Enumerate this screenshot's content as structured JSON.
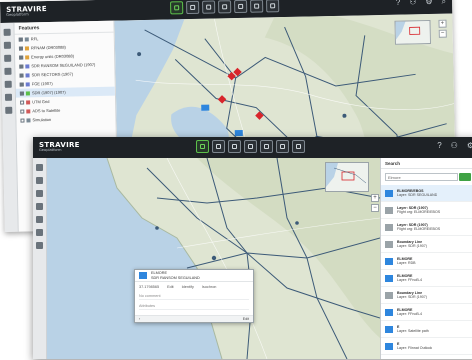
{
  "app": {
    "logo_line1": "STRAVIRE",
    "logo_line2": "Geoplatform"
  },
  "topbar": {
    "help": "?",
    "user": "⚇",
    "settings": "⚙",
    "search": "⌕"
  },
  "layers_panel": {
    "title": "Features",
    "rows": [
      {
        "label": "RFL",
        "color": "#7a8a96"
      },
      {
        "label": "RFNAM (DR03088)",
        "color": "#e0a33c"
      },
      {
        "label": "Energy units (DR03088)",
        "color": "#e0a33c"
      },
      {
        "label": "SDR RANSOM SEGUILAND (1907)",
        "color": "#6b7bd0"
      },
      {
        "label": "SDR SECTORS (1907)",
        "color": "#6b7bd0"
      },
      {
        "label": "FGE (1907)",
        "color": "#6b7bd0"
      },
      {
        "label": "SDR (1907) (1907)",
        "color": "#5cc04a"
      },
      {
        "label": "UTM Grid",
        "color": "#d05a5a"
      },
      {
        "label": "ADS to Satellite",
        "color": "#d05a5a"
      },
      {
        "label": "Simulation",
        "color": "#7a8a96"
      }
    ]
  },
  "search_panel": {
    "title": "Search",
    "query": "Elmore",
    "results": [
      {
        "title": "ELMORE/EBOS",
        "sub": "Layer: SDR SEGUILAND",
        "color": "#2e86de"
      },
      {
        "title": "Layer: SDR (1907)",
        "sub": "Flight org: ELMORE/EBOS",
        "color": "#9aa3a8"
      },
      {
        "title": "Layer: SDR (1907)",
        "sub": "Flight org: ELMORE/EBOS",
        "color": "#9aa3a8"
      },
      {
        "title": "Boundary Line",
        "sub": "Layer: SDR (1907)",
        "color": "#9aa3a8"
      },
      {
        "title": "ELMORE",
        "sub": "Layer: RDB",
        "color": "#2e86de"
      },
      {
        "title": "ELMORE",
        "sub": "Layer: FFnoB-4",
        "color": "#2e86de"
      },
      {
        "title": "Boundary Line",
        "sub": "Layer: SDR (1907)",
        "color": "#9aa3a8"
      },
      {
        "title": "ELMORE",
        "sub": "Layer: FFnoB-4",
        "color": "#2e86de"
      },
      {
        "title": "E",
        "sub": "Layer: Satellite path",
        "color": "#2e86de"
      },
      {
        "title": "E",
        "sub": "Layer: Flinnat Outlook",
        "color": "#2e86de"
      }
    ]
  },
  "popup": {
    "title": "ELMORE",
    "subtitle": "SDR RANSOM SEGUILAND",
    "coords": "37.1798565",
    "actions": [
      "Edit",
      "Identify",
      "Isochron"
    ],
    "field1": "No comment",
    "field2": "Attributes",
    "footer_left": "‹",
    "footer_right": "Edit"
  },
  "colors": {
    "topbar": "#1e2226",
    "accent": "#5cc04a",
    "map_land": "#dfe5d2",
    "map_sea": "#b9d2e6",
    "route": "#3c5a78",
    "marker": "#d8252b"
  }
}
